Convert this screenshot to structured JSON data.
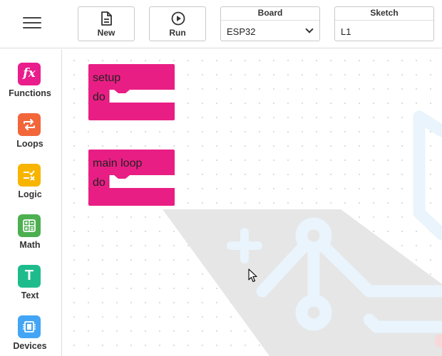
{
  "toolbar": {
    "new_label": "New",
    "run_label": "Run",
    "board_label": "Board",
    "board_value": "ESP32",
    "sketch_label": "Sketch",
    "sketch_value": "L1"
  },
  "sidebar": {
    "items": [
      {
        "label": "Functions",
        "icon": "fx-icon",
        "color": "#e91e8c",
        "glyph": "fx"
      },
      {
        "label": "Loops",
        "icon": "loop-arrows-icon",
        "color": "#f2663a"
      },
      {
        "label": "Logic",
        "icon": "logic-icon",
        "color": "#f7b500"
      },
      {
        "label": "Math",
        "icon": "calculator-icon",
        "color": "#4caf50"
      },
      {
        "label": "Text",
        "icon": "text-icon",
        "color": "#1ebc8c",
        "glyph": "T"
      },
      {
        "label": "Devices",
        "icon": "chip-icon",
        "color": "#42a5f5"
      }
    ]
  },
  "blocks": [
    {
      "title": "setup",
      "do_label": "do",
      "color": "#e91e84"
    },
    {
      "title": "main loop",
      "do_label": "do",
      "color": "#e91e84"
    }
  ]
}
